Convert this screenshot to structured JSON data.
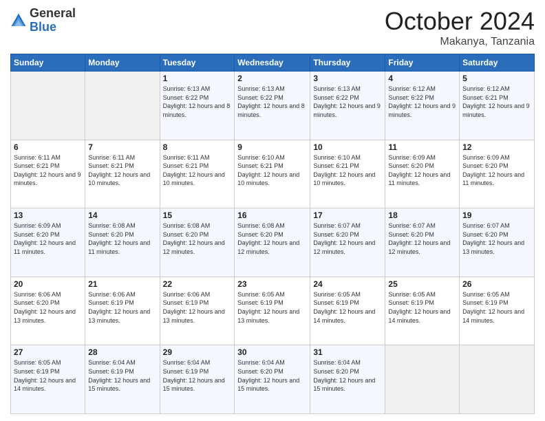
{
  "logo": {
    "general": "General",
    "blue": "Blue"
  },
  "title": {
    "month": "October 2024",
    "location": "Makanya, Tanzania"
  },
  "weekdays": [
    "Sunday",
    "Monday",
    "Tuesday",
    "Wednesday",
    "Thursday",
    "Friday",
    "Saturday"
  ],
  "weeks": [
    [
      {
        "day": "",
        "info": ""
      },
      {
        "day": "",
        "info": ""
      },
      {
        "day": "1",
        "info": "Sunrise: 6:13 AM\nSunset: 6:22 PM\nDaylight: 12 hours and 8 minutes."
      },
      {
        "day": "2",
        "info": "Sunrise: 6:13 AM\nSunset: 6:22 PM\nDaylight: 12 hours and 8 minutes."
      },
      {
        "day": "3",
        "info": "Sunrise: 6:13 AM\nSunset: 6:22 PM\nDaylight: 12 hours and 9 minutes."
      },
      {
        "day": "4",
        "info": "Sunrise: 6:12 AM\nSunset: 6:22 PM\nDaylight: 12 hours and 9 minutes."
      },
      {
        "day": "5",
        "info": "Sunrise: 6:12 AM\nSunset: 6:21 PM\nDaylight: 12 hours and 9 minutes."
      }
    ],
    [
      {
        "day": "6",
        "info": "Sunrise: 6:11 AM\nSunset: 6:21 PM\nDaylight: 12 hours and 9 minutes."
      },
      {
        "day": "7",
        "info": "Sunrise: 6:11 AM\nSunset: 6:21 PM\nDaylight: 12 hours and 10 minutes."
      },
      {
        "day": "8",
        "info": "Sunrise: 6:11 AM\nSunset: 6:21 PM\nDaylight: 12 hours and 10 minutes."
      },
      {
        "day": "9",
        "info": "Sunrise: 6:10 AM\nSunset: 6:21 PM\nDaylight: 12 hours and 10 minutes."
      },
      {
        "day": "10",
        "info": "Sunrise: 6:10 AM\nSunset: 6:21 PM\nDaylight: 12 hours and 10 minutes."
      },
      {
        "day": "11",
        "info": "Sunrise: 6:09 AM\nSunset: 6:20 PM\nDaylight: 12 hours and 11 minutes."
      },
      {
        "day": "12",
        "info": "Sunrise: 6:09 AM\nSunset: 6:20 PM\nDaylight: 12 hours and 11 minutes."
      }
    ],
    [
      {
        "day": "13",
        "info": "Sunrise: 6:09 AM\nSunset: 6:20 PM\nDaylight: 12 hours and 11 minutes."
      },
      {
        "day": "14",
        "info": "Sunrise: 6:08 AM\nSunset: 6:20 PM\nDaylight: 12 hours and 11 minutes."
      },
      {
        "day": "15",
        "info": "Sunrise: 6:08 AM\nSunset: 6:20 PM\nDaylight: 12 hours and 12 minutes."
      },
      {
        "day": "16",
        "info": "Sunrise: 6:08 AM\nSunset: 6:20 PM\nDaylight: 12 hours and 12 minutes."
      },
      {
        "day": "17",
        "info": "Sunrise: 6:07 AM\nSunset: 6:20 PM\nDaylight: 12 hours and 12 minutes."
      },
      {
        "day": "18",
        "info": "Sunrise: 6:07 AM\nSunset: 6:20 PM\nDaylight: 12 hours and 12 minutes."
      },
      {
        "day": "19",
        "info": "Sunrise: 6:07 AM\nSunset: 6:20 PM\nDaylight: 12 hours and 13 minutes."
      }
    ],
    [
      {
        "day": "20",
        "info": "Sunrise: 6:06 AM\nSunset: 6:20 PM\nDaylight: 12 hours and 13 minutes."
      },
      {
        "day": "21",
        "info": "Sunrise: 6:06 AM\nSunset: 6:19 PM\nDaylight: 12 hours and 13 minutes."
      },
      {
        "day": "22",
        "info": "Sunrise: 6:06 AM\nSunset: 6:19 PM\nDaylight: 12 hours and 13 minutes."
      },
      {
        "day": "23",
        "info": "Sunrise: 6:05 AM\nSunset: 6:19 PM\nDaylight: 12 hours and 13 minutes."
      },
      {
        "day": "24",
        "info": "Sunrise: 6:05 AM\nSunset: 6:19 PM\nDaylight: 12 hours and 14 minutes."
      },
      {
        "day": "25",
        "info": "Sunrise: 6:05 AM\nSunset: 6:19 PM\nDaylight: 12 hours and 14 minutes."
      },
      {
        "day": "26",
        "info": "Sunrise: 6:05 AM\nSunset: 6:19 PM\nDaylight: 12 hours and 14 minutes."
      }
    ],
    [
      {
        "day": "27",
        "info": "Sunrise: 6:05 AM\nSunset: 6:19 PM\nDaylight: 12 hours and 14 minutes."
      },
      {
        "day": "28",
        "info": "Sunrise: 6:04 AM\nSunset: 6:19 PM\nDaylight: 12 hours and 15 minutes."
      },
      {
        "day": "29",
        "info": "Sunrise: 6:04 AM\nSunset: 6:19 PM\nDaylight: 12 hours and 15 minutes."
      },
      {
        "day": "30",
        "info": "Sunrise: 6:04 AM\nSunset: 6:20 PM\nDaylight: 12 hours and 15 minutes."
      },
      {
        "day": "31",
        "info": "Sunrise: 6:04 AM\nSunset: 6:20 PM\nDaylight: 12 hours and 15 minutes."
      },
      {
        "day": "",
        "info": ""
      },
      {
        "day": "",
        "info": ""
      }
    ]
  ]
}
